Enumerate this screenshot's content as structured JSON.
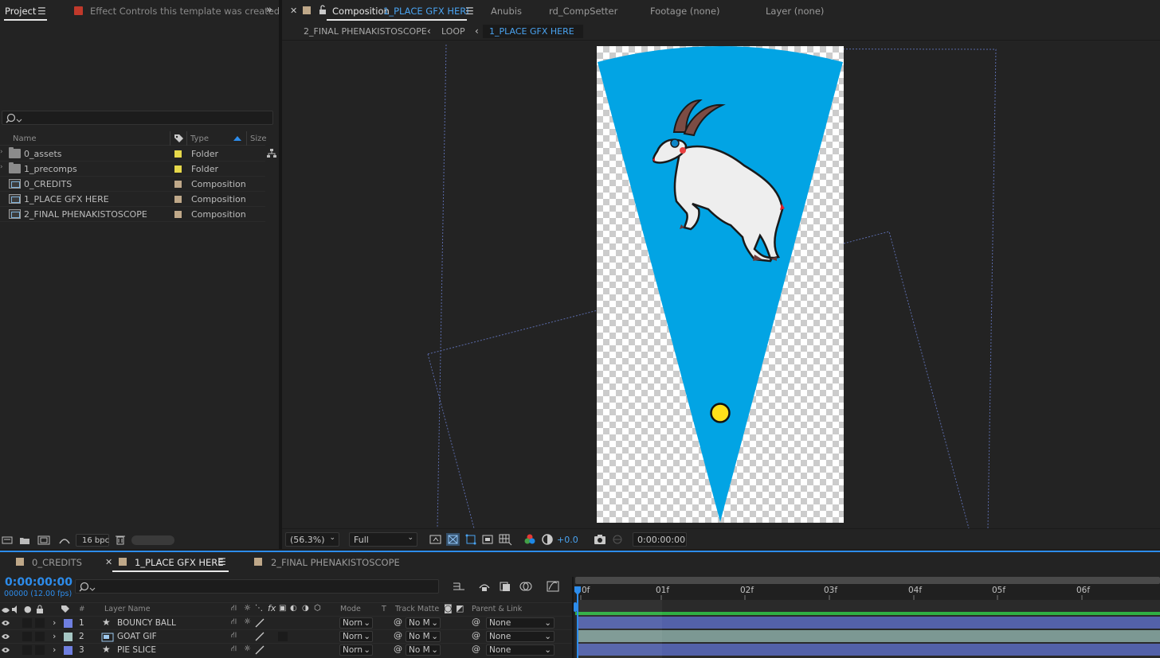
{
  "project": {
    "tab_label": "Project",
    "effect_controls_label": "Effect Controls this template was created",
    "columns": {
      "name": "Name",
      "type": "Type",
      "size": "Size"
    },
    "items": [
      {
        "name": "0_assets",
        "type": "Folder",
        "kind": "folder",
        "label_color": "#e6d84a"
      },
      {
        "name": "1_precomps",
        "type": "Folder",
        "kind": "folder",
        "label_color": "#e6d84a"
      },
      {
        "name": "0_CREDITS",
        "type": "Composition",
        "kind": "comp",
        "label_color": "#bfa889"
      },
      {
        "name": "1_PLACE GFX HERE",
        "type": "Composition",
        "kind": "comp",
        "label_color": "#bfa889"
      },
      {
        "name": "2_FINAL PHENAKISTOSCOPE",
        "type": "Composition",
        "kind": "comp",
        "label_color": "#bfa889"
      }
    ],
    "bpc_label": "16 bpc"
  },
  "viewer": {
    "comp_tab_prefix": "Composition",
    "comp_tab_name": "1_PLACE GFX HERE",
    "other_tabs": [
      "Anubis",
      "rd_CompSetter",
      "Footage (none)",
      "Layer (none)"
    ],
    "breadcrumb": [
      "2_FINAL PHENAKISTOSCOPE",
      "LOOP",
      "1_PLACE GFX HERE"
    ],
    "zoom": "(56.3%)",
    "resolution": "Full",
    "exposure": "+0.0",
    "timecode": "0:00:00:00"
  },
  "timeline": {
    "tabs": [
      {
        "name": "0_CREDITS",
        "active": false
      },
      {
        "name": "1_PLACE GFX HERE",
        "active": true
      },
      {
        "name": "2_FINAL PHENAKISTOSCOPE",
        "active": false
      }
    ],
    "current_time": "0:00:00:00",
    "frame_info": "00000 (12.00 fps)",
    "headers": {
      "hash": "#",
      "layer_name": "Layer Name",
      "fx": "fx",
      "mode": "Mode",
      "t": "T",
      "track_matte": "Track Matte",
      "parent_link": "Parent & Link"
    },
    "ruler": [
      "0f",
      "01f",
      "02f",
      "03f",
      "04f",
      "05f",
      "06f"
    ],
    "layers": [
      {
        "num": "1",
        "name": "BOUNCY BALL",
        "kind": "shape",
        "label_color": "#6f7fe0",
        "mode": "Norn",
        "matte": "No M",
        "parent": "None",
        "bar_color": "#5361a9"
      },
      {
        "num": "2",
        "name": "GOAT GIF",
        "kind": "footage",
        "label_color": "#a6c7c4",
        "mode": "Norn",
        "matte": "No M",
        "parent": "None",
        "bar_color": "#7c9893"
      },
      {
        "num": "3",
        "name": "PIE SLICE",
        "kind": "shape",
        "label_color": "#6f7fe0",
        "mode": "Norn",
        "matte": "No M",
        "parent": "None",
        "bar_color": "#5361a9"
      }
    ]
  },
  "colors": {
    "accent": "#2d8ceb",
    "pie_blue": "#02a4e4",
    "ball_yellow": "#ffe11a"
  }
}
